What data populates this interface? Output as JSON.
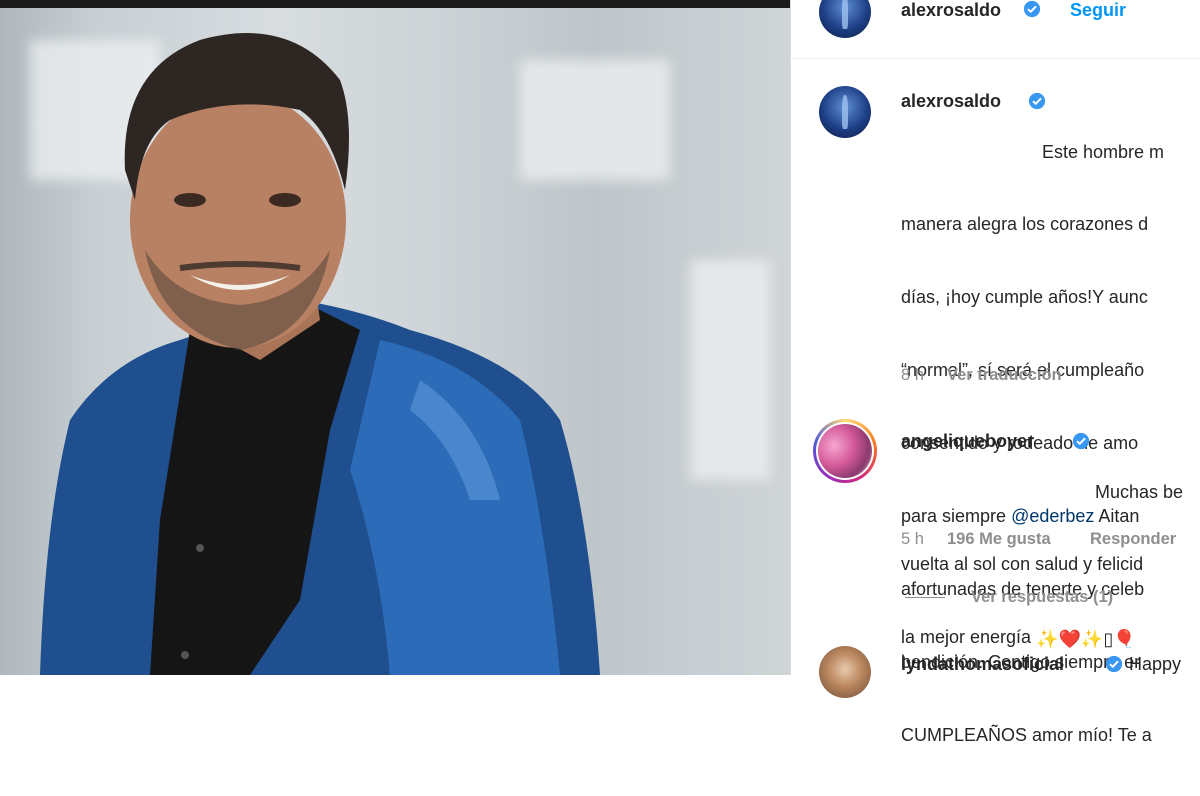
{
  "post": {
    "author": "alexrosaldo",
    "follow_label": "Seguir",
    "caption_lines": [
      "Este hombre m",
      "manera alegra los corazones d",
      "días, ¡hoy cumple años!Y aunc",
      "“normal”, sí será el cumpleaño",
      "consentido y rodeado de amo",
      "para siempre ",
      "afortunadas de tenerte y celeb",
      "bendición. Contigo siempre er",
      "CUMPLEAÑOS amor mío! Te a"
    ],
    "caption_mention": "@ederbez",
    "caption_mention_suffix": " Aitan",
    "time": "8 h",
    "translate_label": "Ver traducción"
  },
  "comments": [
    {
      "username": "angeliqueboyer",
      "text_lines": [
        "Muchas be",
        "vuelta al sol con salud y felicid",
        "la mejor energía "
      ],
      "emoji_tail": "✨❤️✨▯🎈",
      "time": "5 h",
      "likes": "196 Me gusta",
      "reply_label": "Responder",
      "view_replies": "Ver respuestas (1)"
    },
    {
      "username": "lyndathomasoficial",
      "text_lines": [
        "Happy"
      ]
    }
  ],
  "colors": {
    "link": "#0095f6",
    "mention": "#00376b",
    "muted": "#8e8e8e",
    "text": "#262626",
    "verified": "#3897f0"
  }
}
